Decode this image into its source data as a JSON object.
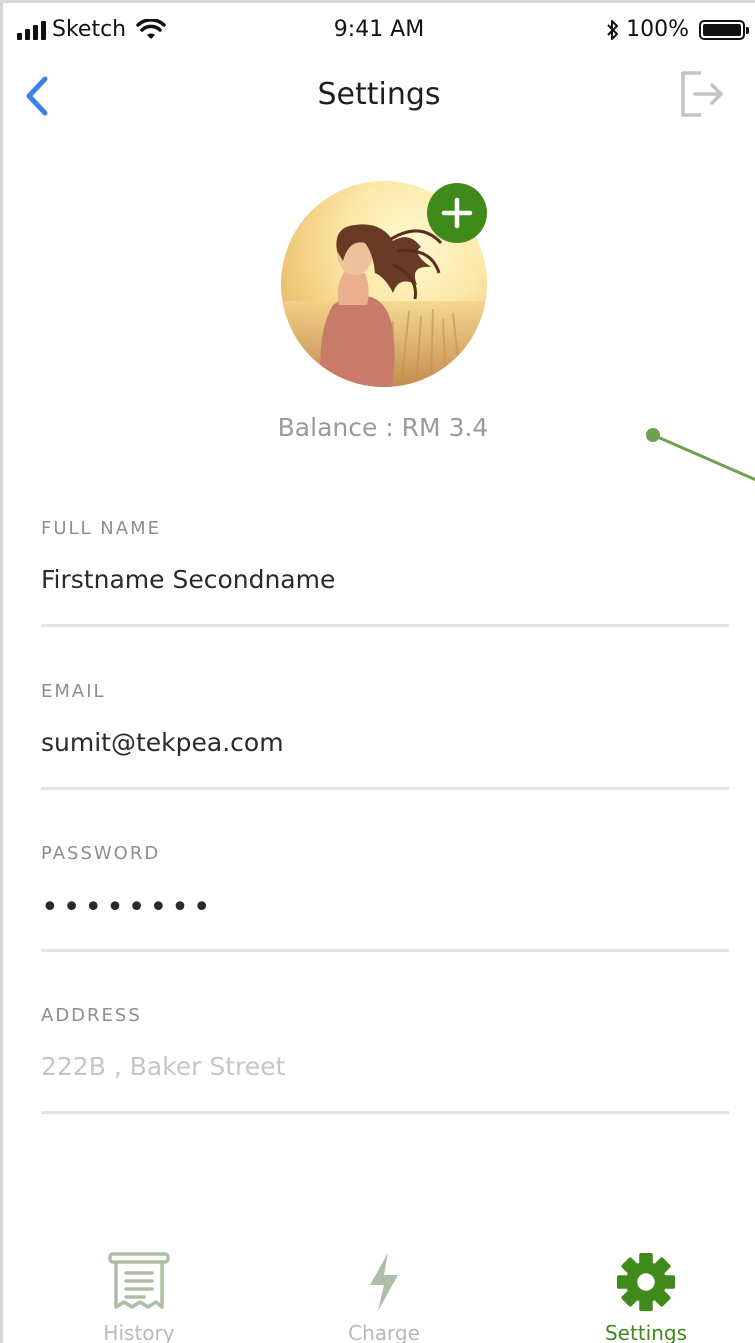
{
  "status_bar": {
    "carrier": "Sketch",
    "time": "9:41 AM",
    "battery": "100%"
  },
  "nav": {
    "title": "Settings"
  },
  "profile": {
    "balance": "Balance : RM 3.4"
  },
  "form": {
    "full_name": {
      "label": "FULL NAME",
      "value": "Firstname Secondname"
    },
    "email": {
      "label": "EMAIL",
      "value": "sumit@tekpea.com"
    },
    "password": {
      "label": "PASSWORD",
      "value": "••••••••"
    },
    "address": {
      "label": "ADDRESS",
      "placeholder": "222B , Baker Street"
    }
  },
  "tabs": [
    {
      "label": "History",
      "icon": "receipt-icon",
      "active": false
    },
    {
      "label": "Charge",
      "icon": "lightning-icon",
      "active": false
    },
    {
      "label": "Settings",
      "icon": "gear-icon",
      "active": true
    }
  ],
  "colors": {
    "accent_green": "#3f8a1a",
    "back_blue": "#3b82e0",
    "inactive_gray": "#b9b9b9"
  }
}
